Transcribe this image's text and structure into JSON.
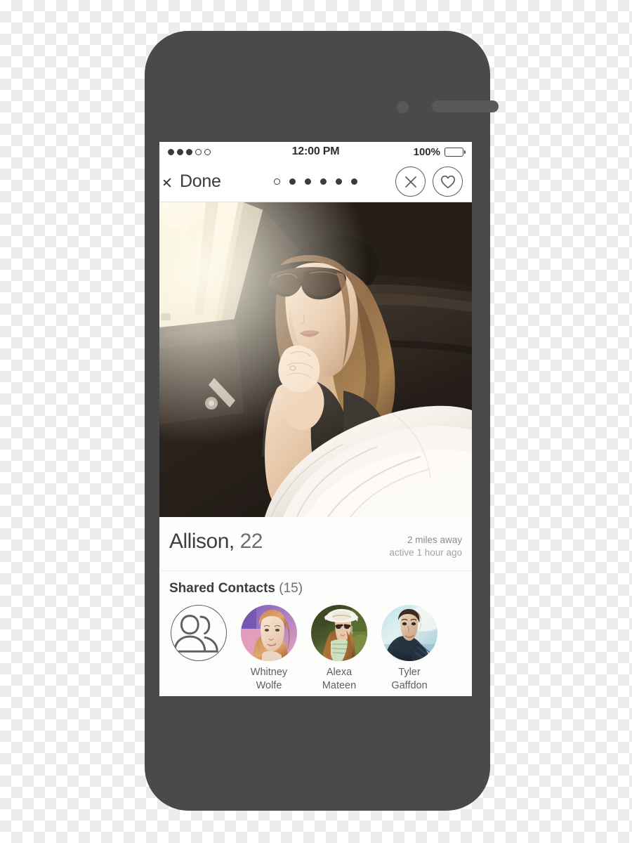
{
  "device": {
    "frame_color": "#4b4a4a",
    "screen_bg": "#ffffff"
  },
  "status_bar": {
    "signal_dots_filled": 3,
    "signal_dots_total": 5,
    "time": "12:00 PM",
    "battery_percent": "100%",
    "battery_level": 100
  },
  "nav_bar": {
    "back_label": "Done",
    "back_icon": "chevron-left-icon",
    "page_dots_total": 6,
    "page_dots_active_index": 0,
    "actions": [
      {
        "name": "close-button",
        "icon": "x-icon"
      },
      {
        "name": "like-button",
        "icon": "heart-icon"
      }
    ]
  },
  "profile": {
    "photo_alt": "woman-in-sunglasses-in-car-photo",
    "name": "Allison,",
    "age": "22",
    "distance": "2 miles away",
    "last_active": "active 1 hour ago"
  },
  "shared_contacts": {
    "heading": "Shared Contacts",
    "count": "(15)",
    "count_value": 15,
    "placeholder_icon": "group-people-icon",
    "people": [
      {
        "first_name": "Whitney",
        "last_name": "Wolfe",
        "avatar": "whitney-avatar"
      },
      {
        "first_name": "Alexa",
        "last_name": "Mateen",
        "avatar": "alexa-avatar"
      },
      {
        "first_name": "Tyler",
        "last_name": "Gaffdon",
        "avatar": "tyler-avatar"
      }
    ]
  },
  "colors": {
    "text_primary": "#3d3d3d",
    "text_secondary": "#8d8d8d",
    "stroke": "#5c5c5c",
    "card_bg": "#fdfdfc"
  }
}
